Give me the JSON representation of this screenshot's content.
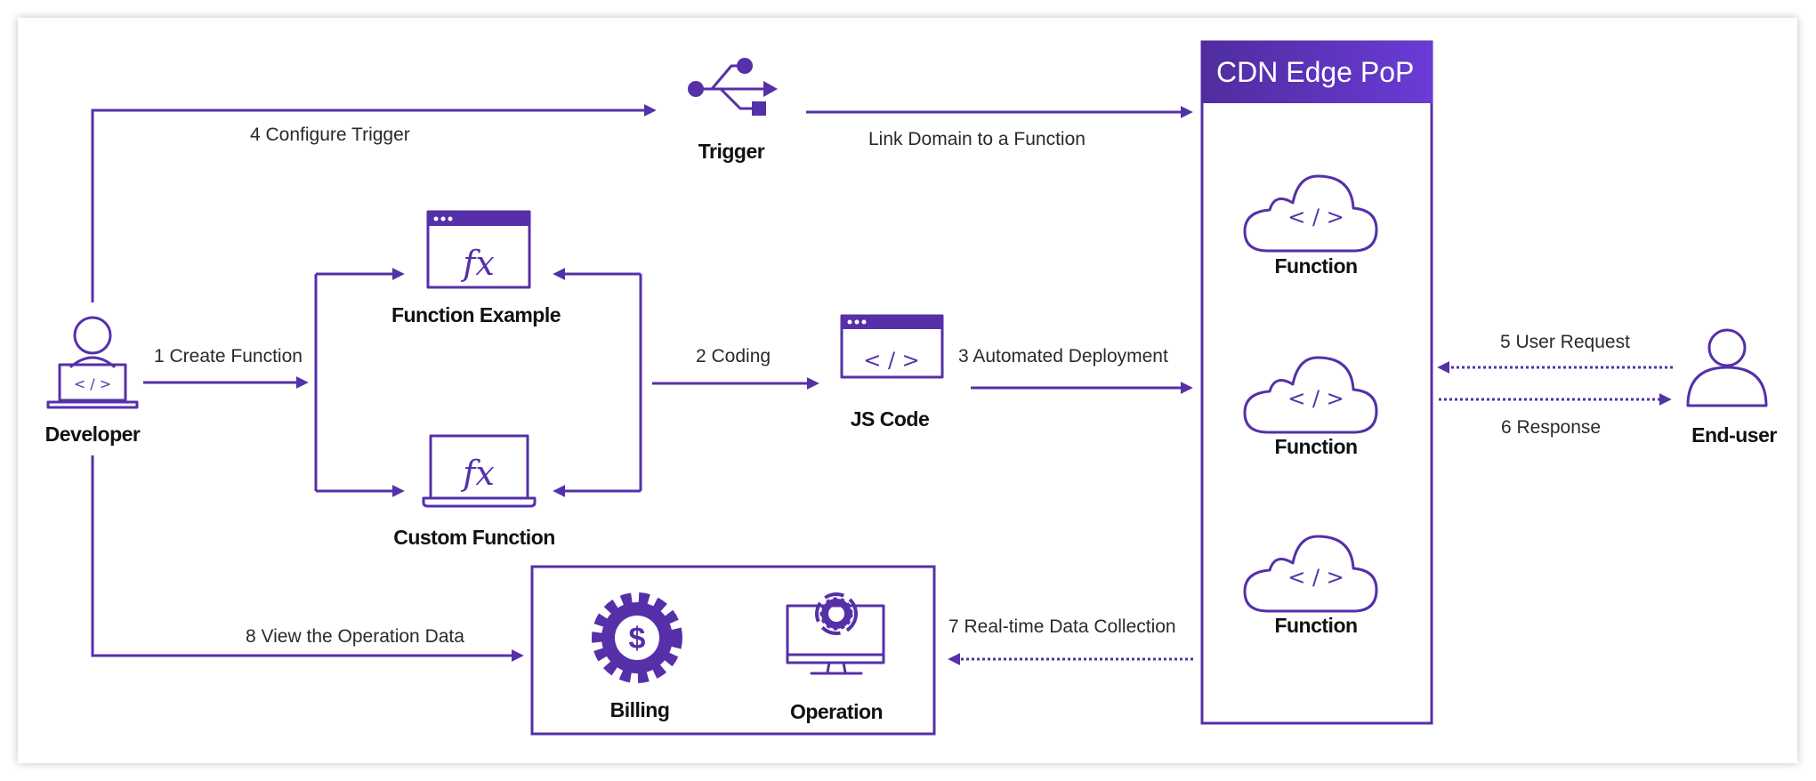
{
  "colors": {
    "accent": "#5530a8",
    "header_start": "#4f2d9e",
    "header_end": "#6a3bd6",
    "text": "#111111"
  },
  "nodes": {
    "developer": "Developer",
    "trigger": "Trigger",
    "function_example": "Function Example",
    "custom_function": "Custom Function",
    "js_code": "JS Code",
    "cdn_title": "CDN Edge PoP",
    "cdn_functions": [
      "Function",
      "Function",
      "Function"
    ],
    "end_user": "End-user",
    "billing": "Billing",
    "operation": "Operation"
  },
  "edges": {
    "create_function": "1 Create Function",
    "coding": "2 Coding",
    "automated_deployment": "3 Automated Deployment",
    "configure_trigger": "4 Configure Trigger",
    "link_domain": "Link Domain to a Function",
    "user_request": "5 User Request",
    "response": "6 Response",
    "data_collection": "7 Real-time Data Collection",
    "view_operation_data": "8 View the Operation Data"
  },
  "icons": {
    "code_glyph": "< / >",
    "fx_glyph": "fx",
    "billing_glyph": "$"
  }
}
